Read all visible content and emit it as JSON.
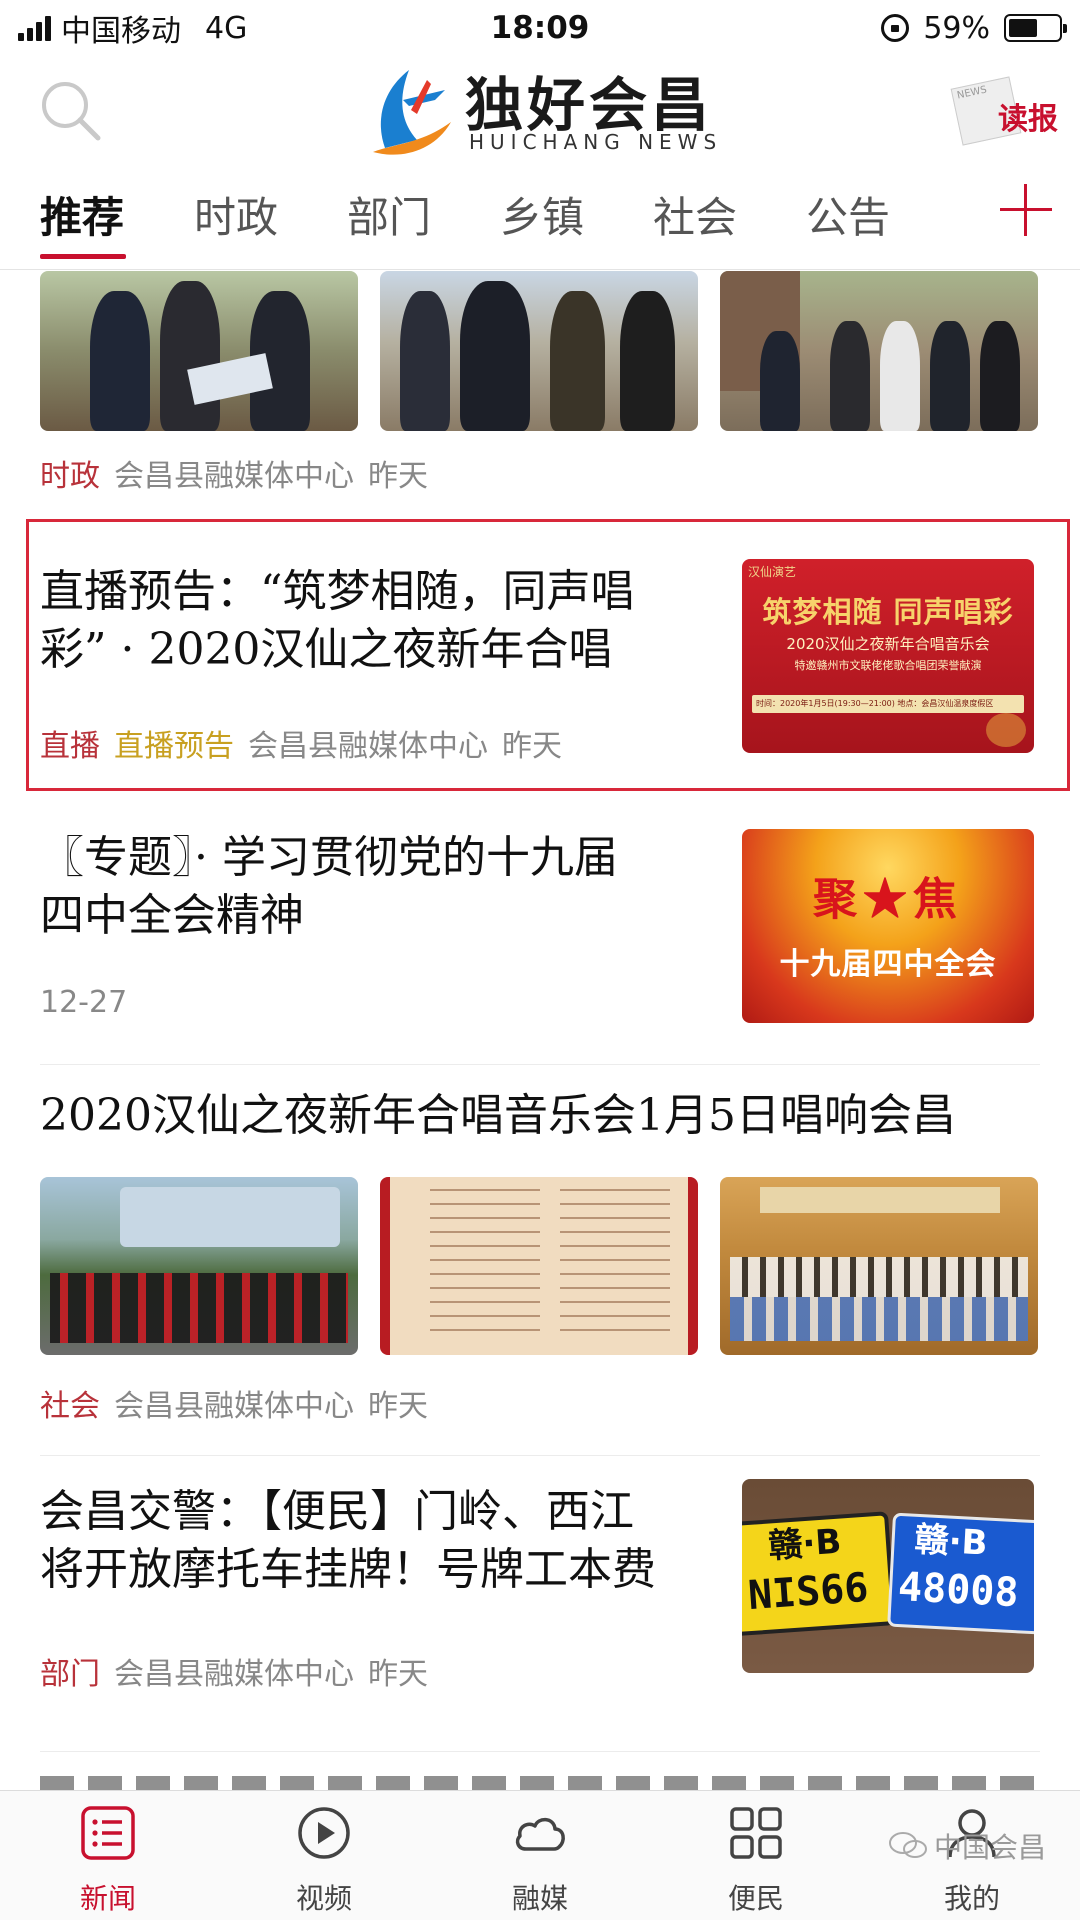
{
  "status_bar": {
    "carrier": "中国移动",
    "network": "4G",
    "time": "18:09",
    "battery": "59%",
    "battery_level": 0.59
  },
  "header": {
    "logo_title": "独好会昌",
    "logo_subtitle": "HUICHANG NEWS",
    "dubao_label": "读报"
  },
  "tabs": [
    "推荐",
    "时政",
    "部门",
    "乡镇",
    "社会",
    "公告"
  ],
  "feed": {
    "item1": {
      "category": "时政",
      "source": "会昌县融媒体中心",
      "time": "昨天"
    },
    "item2": {
      "title_line1": "直播预告：“筑梦相随，同声唱",
      "title_line2": "彩” · 2020汉仙之夜新年合唱",
      "category": "直播",
      "tag": "直播预告",
      "source": "会昌县融媒体中心",
      "time": "昨天",
      "thumb_top_left": "汉仙演艺",
      "thumb_headline": "筑梦相随 同声唱彩",
      "thumb_sub": "2020汉仙之夜新年合唱音乐会",
      "thumb_sub2": "特邀赣州市文联佬佬歌合唱团荣誉献演",
      "thumb_info": "时间：2020年1月5日(19:30—21:00)  地点：会昌汉仙温泉度假区"
    },
    "item3": {
      "title_line1": "〖专题〗· 学习贯彻党的十九届",
      "title_line2": "四中全会精神",
      "date": "12-27",
      "thumb_headline": "聚★焦",
      "thumb_sub": "十九届四中全会"
    },
    "item4": {
      "title": "2020汉仙之夜新年合唱音乐会1月5日唱响会昌",
      "category": "社会",
      "source": "会昌县融媒体中心",
      "time": "昨天"
    },
    "item5": {
      "title_line1": "会昌交警：【便民】门岭、西江",
      "title_line2": "将开放摩托车挂牌！号牌工本费",
      "category": "部门",
      "source": "会昌县融媒体中心",
      "time": "昨天",
      "plate1_top": "赣·B",
      "plate1_num": "NIS66",
      "plate2_top": "赣·B",
      "plate2_num": "48008"
    }
  },
  "bottom_nav": [
    {
      "label": "新闻",
      "icon": "news-list-icon"
    },
    {
      "label": "视频",
      "icon": "play-circle-icon"
    },
    {
      "label": "融媒",
      "icon": "cloud-icon"
    },
    {
      "label": "便民",
      "icon": "grid-icon"
    },
    {
      "label": "我的",
      "icon": "person-icon"
    }
  ],
  "watermark": "中国会昌",
  "colors": {
    "accent": "#c8102e",
    "tag_gold": "#c8a020",
    "meta_gray": "#888888"
  }
}
